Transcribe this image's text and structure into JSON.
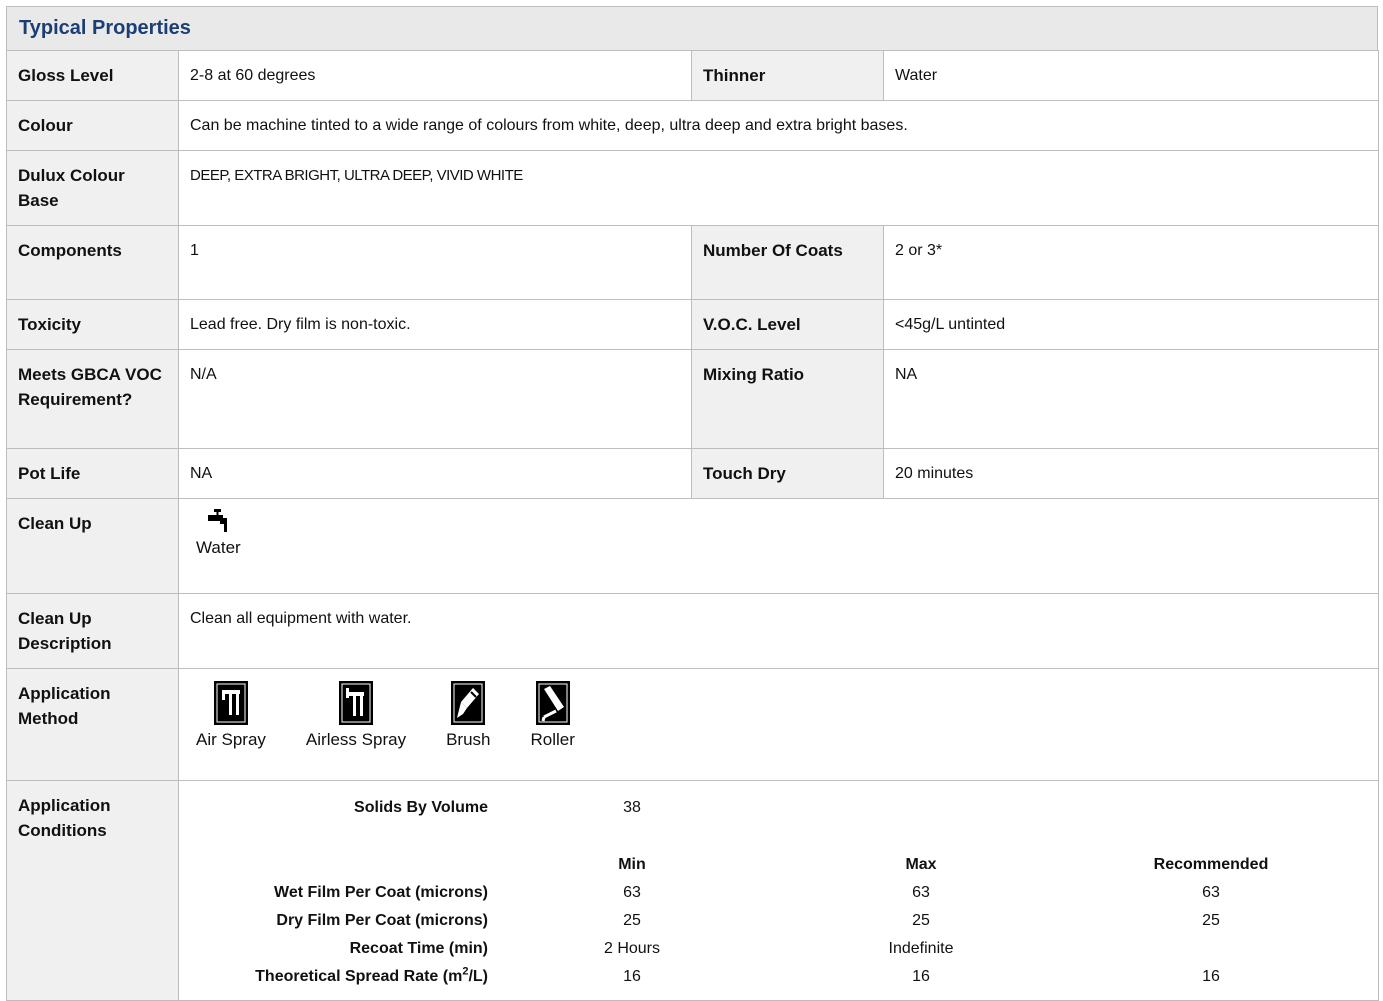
{
  "section_title": "Typical Properties",
  "rows": {
    "gloss": {
      "label": "Gloss Level",
      "value": "2-8 at 60 degrees"
    },
    "thinner": {
      "label": "Thinner",
      "value": "Water"
    },
    "colour": {
      "label": "Colour",
      "value": "Can be machine tinted to a wide range of colours from white, deep, ultra deep and extra bright bases."
    },
    "base": {
      "label": "Dulux Colour Base",
      "value": "DEEP, EXTRA BRIGHT, ULTRA DEEP, VIVID WHITE"
    },
    "components": {
      "label": "Components",
      "value": "1"
    },
    "coats": {
      "label": "Number Of Coats",
      "value": "2 or 3*"
    },
    "toxicity": {
      "label": "Toxicity",
      "value": "Lead free. Dry film is non-toxic."
    },
    "voc": {
      "label": "V.O.C. Level",
      "value": "<45g/L untinted"
    },
    "gbca": {
      "label": "Meets GBCA VOC Requirement?",
      "value": "N/A"
    },
    "mixing": {
      "label": "Mixing Ratio",
      "value": "NA"
    },
    "potlife": {
      "label": "Pot Life",
      "value": "NA"
    },
    "touchdry": {
      "label": "Touch Dry",
      "value": "20 minutes"
    },
    "cleanup": {
      "label": "Clean Up",
      "items": [
        {
          "caption": "Water",
          "icon": "tap-icon"
        }
      ]
    },
    "cleanup_desc": {
      "label": "Clean Up Description",
      "value": "Clean all equipment with water."
    },
    "method": {
      "label": "Application Method",
      "items": [
        {
          "caption": "Air Spray",
          "icon": "air-spray-icon"
        },
        {
          "caption": "Airless Spray",
          "icon": "airless-spray-icon"
        },
        {
          "caption": "Brush",
          "icon": "brush-icon"
        },
        {
          "caption": "Roller",
          "icon": "roller-icon"
        }
      ]
    },
    "conditions": {
      "label": "Application Conditions",
      "solids_label": "Solids By Volume",
      "solids_value": "38",
      "col_min": "Min",
      "col_max": "Max",
      "col_rec": "Recommended",
      "wet": {
        "label": "Wet Film Per Coat (microns)",
        "min": "63",
        "max": "63",
        "rec": "63"
      },
      "dry": {
        "label": "Dry Film Per Coat (microns)",
        "min": "25",
        "max": "25",
        "rec": "25"
      },
      "recoat": {
        "label": "Recoat Time (min)",
        "min": "2 Hours",
        "max": "Indefinite",
        "rec": ""
      },
      "spread": {
        "label_prefix": "Theoretical Spread Rate (m",
        "label_sup": "2",
        "label_suffix": "/L)",
        "min": "16",
        "max": "16",
        "rec": "16"
      }
    }
  }
}
